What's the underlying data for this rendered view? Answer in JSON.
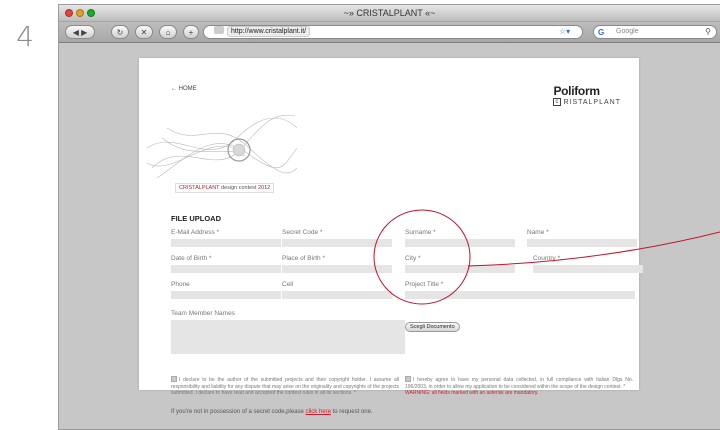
{
  "step_number": "4",
  "window": {
    "title": "~» CRISTALPLANT «~",
    "url": "http://www.cristalplant.it/",
    "search_placeholder": "Google"
  },
  "page": {
    "home_link": "← HOME",
    "brand": {
      "name": "Poliform",
      "sub": "RISTALPLANT"
    },
    "contest_badge": {
      "prefix": "CRISTALPLANT",
      "middle": " design contest ",
      "year": "2012"
    },
    "section_title": "FILE UPLOAD",
    "fields": {
      "email": "E-Mail Address *",
      "secret_code": "Secret Code *",
      "surname": "Surname *",
      "name": "Name *",
      "dob": "Date of Birth *",
      "place_of_birth": "Place of Birth *",
      "city": "City *",
      "country": "Country *",
      "phone": "Phone",
      "cell": "Cell",
      "project_title": "Project Title *"
    },
    "team_label": "Team Member Names",
    "upload_button": "Scegli Documento",
    "consent_left": "I declare to be the author of the submitted projects and their copyright holder. I assume all responsibility and liability for any dispute that may arise on the originality and copyrights of the projects submitted. I declare to have read and accepted the contest rules in all its sections. *",
    "consent_right": "I hereby agree to have my personal data collected, in full compliance with Italian Dlgs No. 196/2003, in order to allow my application to be considered within the scope of the design contest. *",
    "consent_warning": "WARNING: all fields marked with an asterisk are mandatory.",
    "footnote_prefix": "If you're not in possession of a secret code,please ",
    "footnote_link": "click here",
    "footnote_suffix": " to request one."
  },
  "colors": {
    "accent_red": "#d21c2b",
    "annotation_red": "#c2142a"
  }
}
